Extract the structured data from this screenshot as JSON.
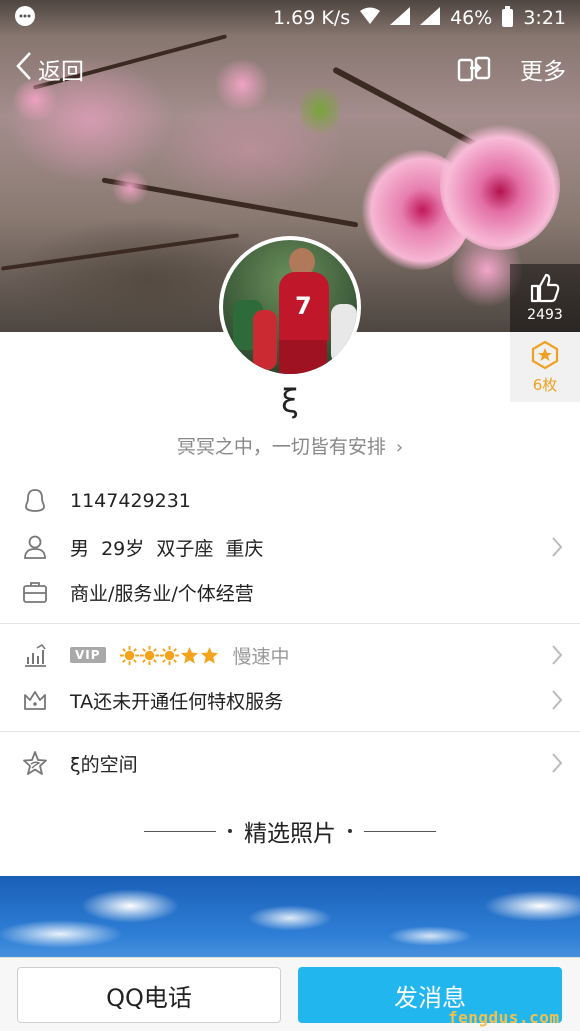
{
  "status_bar": {
    "network_speed": "1.69 K/s",
    "battery": "46%",
    "time": "3:21"
  },
  "nav": {
    "back_label": "返回",
    "more_label": "更多"
  },
  "likes": {
    "count": "2493"
  },
  "badge": {
    "count_label": "6枚"
  },
  "profile": {
    "nickname": "ξ",
    "signature": "冥冥之中，一切皆有安排",
    "signature_chevron": "›"
  },
  "info": {
    "qq_number": "1147429231",
    "personal": "男  29岁  双子座  重庆",
    "occupation": "商业/服务业/个体经营"
  },
  "privileges": {
    "vip_tag": "VIP",
    "vip_status": "慢速中",
    "services": "TA还未开通任何特权服务"
  },
  "space": {
    "label": "ξ的空间"
  },
  "photos": {
    "section_title": "精选照片"
  },
  "actions": {
    "call_label": "QQ电话",
    "message_label": "发消息"
  },
  "watermark": "fengdus.com",
  "colors": {
    "accent": "#22b6ef",
    "badge": "#f0a020",
    "secondary_text": "#888888"
  }
}
